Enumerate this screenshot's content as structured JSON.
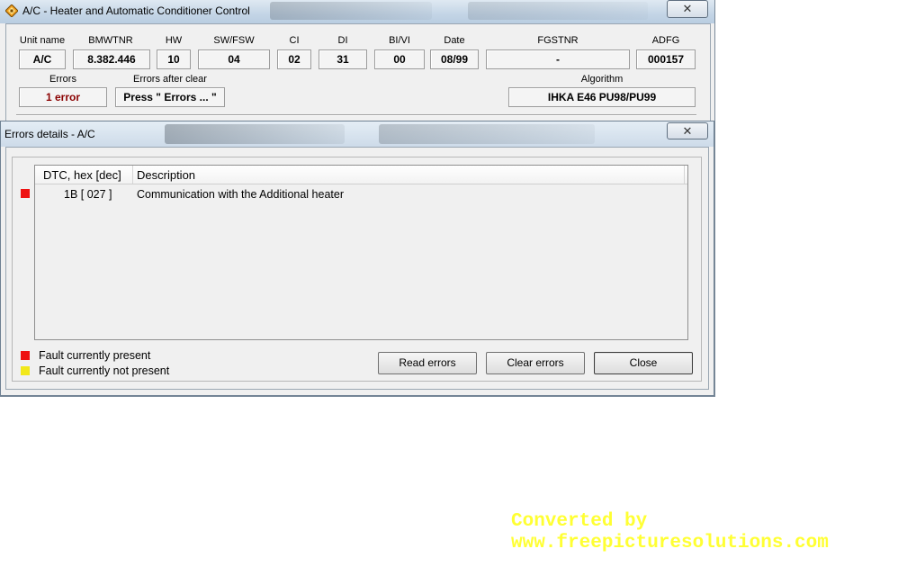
{
  "main_window": {
    "title": "A/C - Heater and Automatic Conditioner Control",
    "close_label": "✕",
    "fields": {
      "unit_name": {
        "label": "Unit name",
        "value": "A/C"
      },
      "bmwtnr": {
        "label": "BMWTNR",
        "value": "8.382.446"
      },
      "hw": {
        "label": "HW",
        "value": "10"
      },
      "sw_fsw": {
        "label": "SW/FSW",
        "value": "04"
      },
      "ci": {
        "label": "CI",
        "value": "02"
      },
      "di": {
        "label": "DI",
        "value": "31"
      },
      "bi_vi": {
        "label": "BI/VI",
        "value": "00"
      },
      "date": {
        "label": "Date",
        "value": "08/99"
      },
      "fgstnr": {
        "label": "FGSTNR",
        "value": "-"
      },
      "adfg": {
        "label": "ADFG",
        "value": "000157"
      },
      "errors": {
        "label": "Errors",
        "value": "1 error"
      },
      "errors_after_clear": {
        "label": "Errors after clear",
        "value": "Press \" Errors ... \""
      },
      "algorithm": {
        "label": "Algorithm",
        "value": "IHKA E46 PU98/PU99"
      }
    }
  },
  "errors_dialog": {
    "title": "Errors details - A/C",
    "close_label": "✕",
    "columns": [
      "DTC, hex [dec]",
      "Description"
    ],
    "rows": [
      {
        "dtc": "1B [ 027 ]",
        "description": "Communication with the Additional heater",
        "status": "present"
      }
    ],
    "legend": {
      "present": "Fault currently present",
      "not_present": "Fault currently not present"
    },
    "buttons": {
      "read": "Read errors",
      "clear": "Clear errors",
      "close": "Close"
    }
  },
  "colors": {
    "fault_present": "#ee1111",
    "fault_not_present": "#f2e81a",
    "error_count": "#8a0000",
    "watermark": "#ffff33"
  },
  "watermark": {
    "line1": "Converted by",
    "line2": "www.freepicturesolutions.com"
  }
}
